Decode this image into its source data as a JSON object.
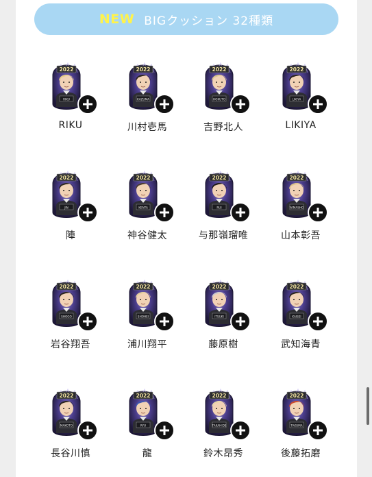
{
  "banner": {
    "new_label": "NEW",
    "title": "BIGクッション 32種類"
  },
  "cushion_year": "2022",
  "members": [
    {
      "name": "RIKU",
      "tag": "RIKU",
      "hair": "#e6cc86"
    },
    {
      "name": "川村壱馬",
      "tag": "KAZUMA",
      "hair": "#2b2420"
    },
    {
      "name": "吉野北人",
      "tag": "HOKUTO",
      "hair": "#d9c48d"
    },
    {
      "name": "LIKIYA",
      "tag": "LIKIYA",
      "hair": "#2a221e"
    },
    {
      "name": "陣",
      "tag": "JIN",
      "hair": "#2c2622"
    },
    {
      "name": "神谷健太",
      "tag": "KENTA",
      "hair": "#4a3a2e"
    },
    {
      "name": "与那嶺瑠唯",
      "tag": "RUI",
      "hair": "#1f1b19"
    },
    {
      "name": "山本彰吾",
      "tag": "YAMASHO",
      "hair": "#dcc48a"
    },
    {
      "name": "岩谷翔吾",
      "tag": "SHOGO",
      "hair": "#2a2420"
    },
    {
      "name": "浦川翔平",
      "tag": "SHOHEI",
      "hair": "#e2cf9a"
    },
    {
      "name": "藤原樹",
      "tag": "ITSUKI",
      "hair": "#c9c9cc"
    },
    {
      "name": "武知海青",
      "tag": "KAISEI",
      "hair": "#2a2420"
    },
    {
      "name": "長谷川慎",
      "tag": "MAKOTO",
      "hair": "#2a2420"
    },
    {
      "name": "龍",
      "tag": "RYU",
      "hair": "#3c55b0"
    },
    {
      "name": "鈴木昂秀",
      "tag": "TAKAHIDE",
      "hair": "#e7d6a8"
    },
    {
      "name": "後藤拓磨",
      "tag": "TAKUMA",
      "hair": "#cc4a2a"
    }
  ],
  "colors": {
    "banner_bg": "#a9d7f3",
    "new_label": "#fff34a",
    "cushion_galaxy": "#3b2e6e",
    "plus_badge": "#111111"
  },
  "icons": {
    "add": "plus-circle-icon"
  }
}
